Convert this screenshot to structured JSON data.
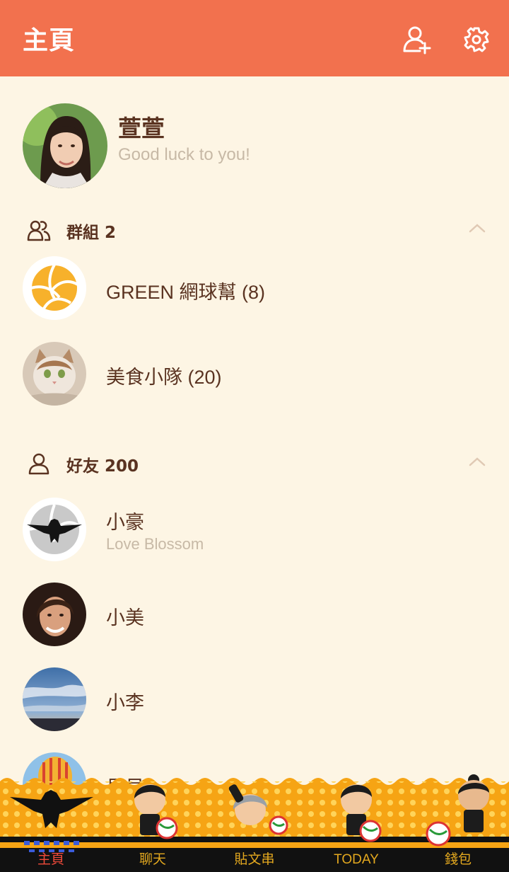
{
  "header": {
    "title": "主頁",
    "add_friend_icon": "add-friend-icon",
    "settings_icon": "gear-icon"
  },
  "profile": {
    "name": "萱萱",
    "status": "Good luck to you!"
  },
  "groups": {
    "label": "群組 2",
    "items": [
      {
        "name": "GREEN 網球幫 (8)",
        "avatar": "volleyball"
      },
      {
        "name": "美食小隊 (20)",
        "avatar": "cat-photo"
      }
    ]
  },
  "friends": {
    "label": "好友 200",
    "items": [
      {
        "name": "小豪",
        "status": "Love Blossom",
        "avatar": "crow-volleyball"
      },
      {
        "name": "小美",
        "status": "",
        "avatar": "woman-photo"
      },
      {
        "name": "小李",
        "status": "",
        "avatar": "sky-photo"
      },
      {
        "name": "貝貝",
        "status": "",
        "avatar": "balloon-photo"
      }
    ]
  },
  "tabs": [
    {
      "label": "主頁",
      "active": true
    },
    {
      "label": "聊天",
      "active": false
    },
    {
      "label": "貼文串",
      "active": false
    },
    {
      "label": "TODAY",
      "active": false
    },
    {
      "label": "錢包",
      "active": false
    }
  ],
  "colors": {
    "header": "#f2714e",
    "background": "#fdf5e4",
    "text": "#5a3321",
    "muted": "#c7b9a6",
    "tabbar": "#f6a414",
    "active_tab": "#f04a3a"
  }
}
